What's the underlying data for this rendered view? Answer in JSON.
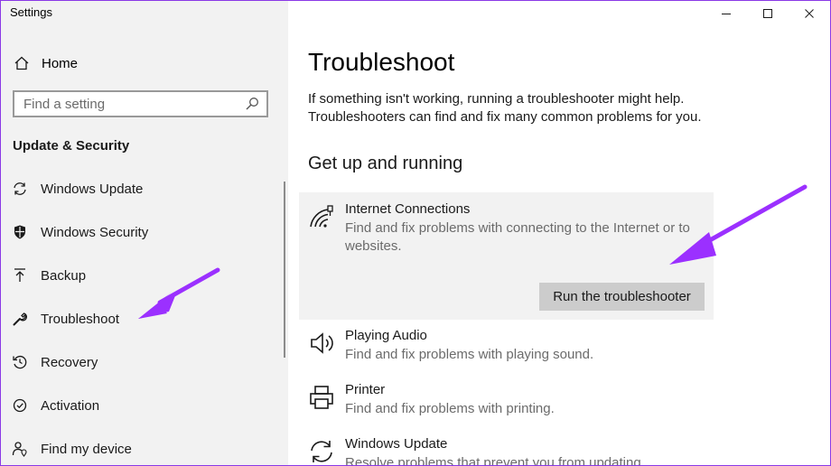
{
  "window": {
    "title": "Settings"
  },
  "sidebar": {
    "home_label": "Home",
    "search_placeholder": "Find a setting",
    "section_title": "Update & Security",
    "items": [
      {
        "label": "Windows Update",
        "icon": "sync-icon"
      },
      {
        "label": "Windows Security",
        "icon": "shield-icon"
      },
      {
        "label": "Backup",
        "icon": "backup-arrow-icon"
      },
      {
        "label": "Troubleshoot",
        "icon": "wrench-icon"
      },
      {
        "label": "Recovery",
        "icon": "recovery-icon"
      },
      {
        "label": "Activation",
        "icon": "activation-icon"
      },
      {
        "label": "Find my device",
        "icon": "person-location-icon"
      }
    ]
  },
  "main": {
    "title": "Troubleshoot",
    "intro_lines": [
      "If something isn't working, running a troubleshooter might help.",
      "Troubleshooters can find and fix many common problems for you."
    ],
    "section_heading": "Get up and running",
    "troubleshooters": [
      {
        "title": "Internet Connections",
        "description": "Find and fix problems with connecting to the Internet or to websites.",
        "icon": "wifi-network-icon",
        "expanded": true
      },
      {
        "title": "Playing Audio",
        "description": "Find and fix problems with playing sound.",
        "icon": "speaker-icon"
      },
      {
        "title": "Printer",
        "description": "Find and fix problems with printing.",
        "icon": "printer-icon"
      },
      {
        "title": "Windows Update",
        "description": "Resolve problems that prevent you from updating",
        "icon": "sync-icon"
      }
    ],
    "run_button_label": "Run the troubleshooter"
  },
  "colors": {
    "annotation_arrow": "#9b30ff",
    "sidebar_bg": "#f2f2f2",
    "selected_card_bg": "#f2f2f2",
    "button_bg": "#cccccc"
  }
}
